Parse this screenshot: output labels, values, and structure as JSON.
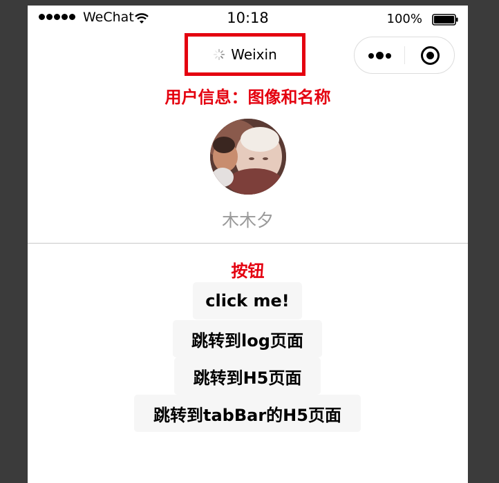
{
  "status_bar": {
    "carrier": "WeChat",
    "time": "10:18",
    "battery": "100%"
  },
  "nav": {
    "title": "Weixin",
    "highlight_color": "#e4000f"
  },
  "userinfo": {
    "section_title": "用户信息：图像和名称",
    "nickname": "木木夕"
  },
  "buttons": {
    "section_title": "按钮",
    "items": [
      {
        "label": "click me!"
      },
      {
        "label": "跳转到log页面"
      },
      {
        "label": "跳转到H5页面"
      },
      {
        "label": "跳转到tabBar的H5页面"
      }
    ]
  },
  "icons": [
    "signal-icon",
    "wifi-icon",
    "battery-icon",
    "loading-icon",
    "more-icon",
    "close-miniprogram-icon"
  ],
  "colors": {
    "accent": "#e4000f",
    "button_bg": "#f6f6f6",
    "nickname": "#999999"
  }
}
